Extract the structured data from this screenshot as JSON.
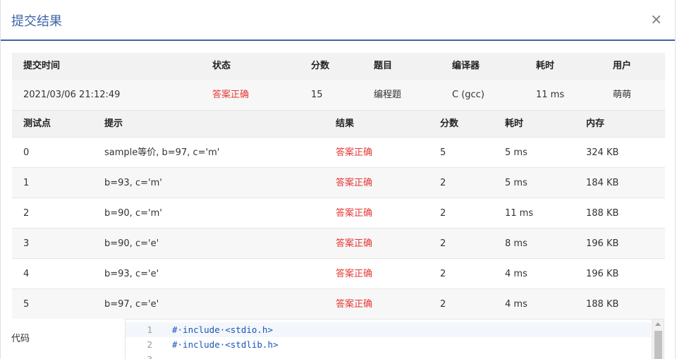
{
  "modal": {
    "title": "提交结果",
    "close_symbol": "×"
  },
  "summary": {
    "headers": [
      "提交时间",
      "状态",
      "分数",
      "题目",
      "编译器",
      "耗时",
      "用户"
    ],
    "values": [
      "2021/03/06 21:12:49",
      "答案正确",
      "15",
      "编程题",
      "C (gcc)",
      "11 ms",
      "萌萌"
    ]
  },
  "testcases": {
    "headers": [
      "测试点",
      "提示",
      "结果",
      "分数",
      "耗时",
      "内存"
    ],
    "rows": [
      [
        "0",
        "sample等价, b=97, c='m'",
        "答案正确",
        "5",
        "5 ms",
        "324 KB"
      ],
      [
        "1",
        "b=93, c='m'",
        "答案正确",
        "2",
        "5 ms",
        "184 KB"
      ],
      [
        "2",
        "b=90, c='m'",
        "答案正确",
        "2",
        "11 ms",
        "188 KB"
      ],
      [
        "3",
        "b=90, c='e'",
        "答案正确",
        "2",
        "8 ms",
        "196 KB"
      ],
      [
        "4",
        "b=93, c='e'",
        "答案正确",
        "2",
        "4 ms",
        "196 KB"
      ],
      [
        "5",
        "b=97, c='e'",
        "答案正确",
        "2",
        "4 ms",
        "188 KB"
      ]
    ]
  },
  "code": {
    "label": "代码",
    "lines": [
      {
        "num": "1",
        "text": "#·include·<stdio.h>"
      },
      {
        "num": "2",
        "text": "#·include·<stdlib.h>"
      },
      {
        "num": "3",
        "text": ""
      }
    ]
  },
  "colors": {
    "accent": "#3e64a8",
    "status_ok": "#e53935"
  }
}
